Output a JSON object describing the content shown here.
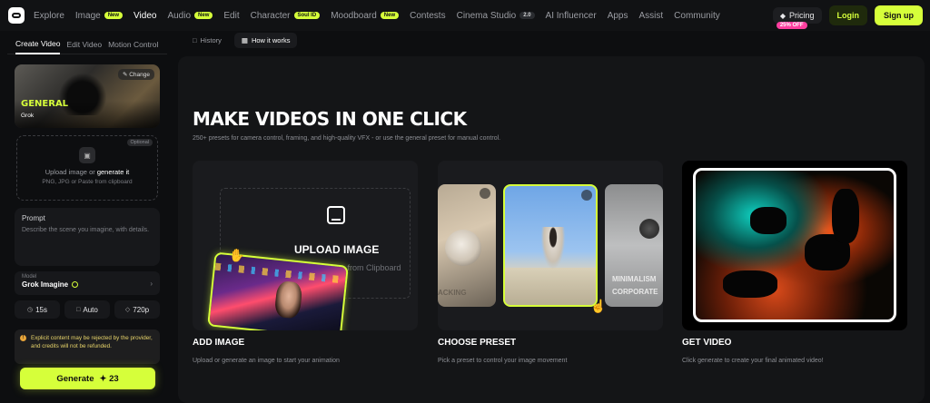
{
  "nav": {
    "items": [
      {
        "label": "Explore"
      },
      {
        "label": "Image",
        "badge": "New"
      },
      {
        "label": "Video",
        "active": true
      },
      {
        "label": "Audio",
        "badge": "New"
      },
      {
        "label": "Edit"
      },
      {
        "label": "Character",
        "badge": "Soul ID"
      },
      {
        "label": "Moodboard",
        "badge": "New"
      },
      {
        "label": "Contests"
      },
      {
        "label": "Cinema Studio",
        "badge": "2.0"
      },
      {
        "label": "AI Influencer"
      },
      {
        "label": "Apps"
      },
      {
        "label": "Assist"
      },
      {
        "label": "Community"
      }
    ],
    "pricing": "Pricing",
    "pricing_badge": "25% OFF",
    "login": "Login",
    "signup": "Sign up"
  },
  "sidebar": {
    "tabs": [
      "Create Video",
      "Edit Video",
      "Motion Control"
    ],
    "preset": {
      "name": "GENERAL",
      "model": "Grok",
      "change": "Change"
    },
    "upload": {
      "optional": "Optional",
      "text_prefix": "Upload image or ",
      "text_link": "generate it",
      "formats": "PNG, JPG or Paste from clipboard"
    },
    "prompt": {
      "label": "Prompt",
      "placeholder": "Describe the scene you imagine, with details."
    },
    "model": {
      "label": "Model",
      "value": "Grok Imagine"
    },
    "options": {
      "duration": "15s",
      "aspect": "Auto",
      "resolution": "720p"
    },
    "warning": "Explicit content may be rejected by the provider, and credits will not be refunded.",
    "generate": {
      "label": "Generate",
      "credits": "23"
    }
  },
  "main": {
    "tabs": [
      "History",
      "How it works"
    ],
    "title": "MAKE VIDEOS IN ONE CLICK",
    "subtitle": "250+ presets for camera control, framing, and high-quality VFX - or use the general preset for manual control.",
    "upload_card": {
      "title": "UPLOAD IMAGE",
      "paste": "Paste from Clipboard"
    },
    "preset_labels": {
      "left": "ACKING",
      "right_1": "MINIMALISM",
      "right_2": "CORPORATE"
    },
    "steps": [
      {
        "title": "ADD IMAGE",
        "desc": "Upload or generate an image to start your animation"
      },
      {
        "title": "CHOOSE PRESET",
        "desc": "Pick a preset to control your image movement"
      },
      {
        "title": "GET VIDEO",
        "desc": "Click generate to create your final animated video!"
      }
    ]
  },
  "colors": {
    "accent": "#d6ff3a",
    "badge_pink": "#ff3fa0",
    "background": "#0d0e10"
  }
}
